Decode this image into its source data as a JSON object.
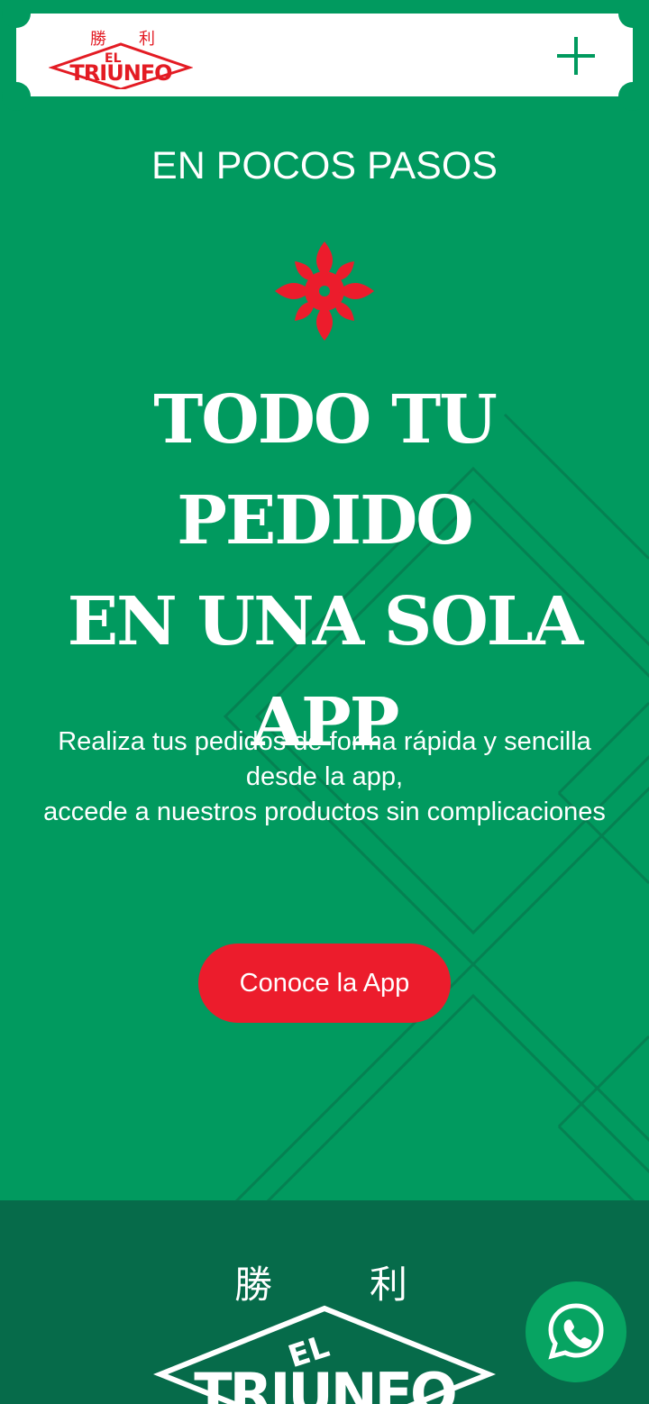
{
  "header": {
    "logo_text": "EL TRIUNFO",
    "logo_chinese": "勝 利",
    "menu_icon": "plus-icon"
  },
  "hero": {
    "eyebrow": "EN POCOS PASOS",
    "headline_line1": "TODO TU PEDIDO",
    "headline_line2": "EN UNA SOLA",
    "headline_line3": "APP",
    "description_line1": "Realiza tus pedidos de forma rápida y sencilla desde la app,",
    "description_line2": "accede a nuestros productos sin complicaciones",
    "cta_label": "Conoce la App",
    "ornament_icon": "flower-icon"
  },
  "footer": {
    "logo_text": "EL TRIUNFO",
    "logo_chinese": "勝 利"
  },
  "floating": {
    "whatsapp_icon": "whatsapp-icon"
  },
  "colors": {
    "primary_green": "#019a5f",
    "dark_green": "#066b4a",
    "accent_red": "#ec1c2c",
    "white": "#ffffff"
  }
}
